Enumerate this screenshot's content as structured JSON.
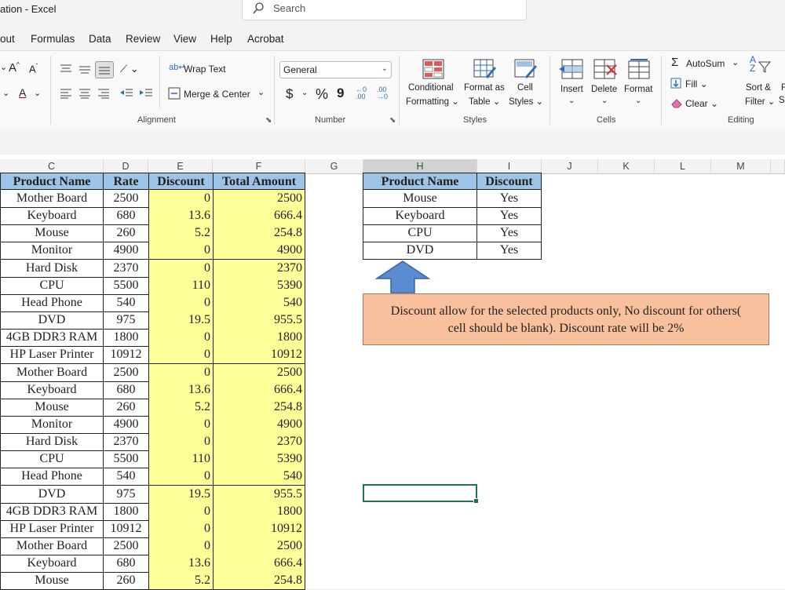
{
  "title_bar": {
    "app_title": "ation  -  Excel",
    "search_placeholder": "Search"
  },
  "menu_tabs": [
    "out",
    "Formulas",
    "Data",
    "Review",
    "View",
    "Help",
    "Acrobat"
  ],
  "ribbon": {
    "alignment": {
      "wrap_text": "Wrap Text",
      "merge_center": "Merge & Center",
      "label": "Alignment"
    },
    "number": {
      "format_value": "General",
      "currency": "$",
      "percent": "%",
      "comma": "9",
      "label": "Number"
    },
    "styles": {
      "conditional_1": "Conditional",
      "conditional_2": "Formatting",
      "format_table_1": "Format as",
      "format_table_2": "Table",
      "cell_styles_1": "Cell",
      "cell_styles_2": "Styles",
      "label": "Styles"
    },
    "cells": {
      "insert": "Insert",
      "delete": "Delete",
      "format": "Format",
      "label": "Cells"
    },
    "editing": {
      "autosum": "AutoSum",
      "fill": "Fill",
      "clear": "Clear",
      "sort_1": "Sort &",
      "sort_2": "Filter",
      "find": "F",
      "find2": "S",
      "label": "Editing"
    },
    "font": {
      "grow": "A",
      "shrink": "A",
      "color": "A"
    }
  },
  "columns": [
    "C",
    "D",
    "E",
    "F",
    "G",
    "H",
    "I",
    "J",
    "K",
    "L",
    "M"
  ],
  "main_table": {
    "headers": [
      "Product Name",
      "Rate",
      "Discount",
      "Total Amount"
    ],
    "rows": [
      [
        "Mother Board",
        "2500",
        "0",
        "2500"
      ],
      [
        "Keyboard",
        "680",
        "13.6",
        "666.4"
      ],
      [
        "Mouse",
        "260",
        "5.2",
        "254.8"
      ],
      [
        "Monitor",
        "4900",
        "0",
        "4900"
      ],
      [
        "Hard Disk",
        "2370",
        "0",
        "2370"
      ],
      [
        "CPU",
        "5500",
        "110",
        "5390"
      ],
      [
        "Head Phone",
        "540",
        "0",
        "540"
      ],
      [
        "DVD",
        "975",
        "19.5",
        "955.5"
      ],
      [
        "4GB DDR3 RAM",
        "1800",
        "0",
        "1800"
      ],
      [
        "HP Laser Printer",
        "10912",
        "0",
        "10912"
      ],
      [
        "Mother Board",
        "2500",
        "0",
        "2500"
      ],
      [
        "Keyboard",
        "680",
        "13.6",
        "666.4"
      ],
      [
        "Mouse",
        "260",
        "5.2",
        "254.8"
      ],
      [
        "Monitor",
        "4900",
        "0",
        "4900"
      ],
      [
        "Hard Disk",
        "2370",
        "0",
        "2370"
      ],
      [
        "CPU",
        "5500",
        "110",
        "5390"
      ],
      [
        "Head Phone",
        "540",
        "0",
        "540"
      ],
      [
        "DVD",
        "975",
        "19.5",
        "955.5"
      ],
      [
        "4GB DDR3 RAM",
        "1800",
        "0",
        "1800"
      ],
      [
        "HP Laser Printer",
        "10912",
        "0",
        "10912"
      ],
      [
        "Mother Board",
        "2500",
        "0",
        "2500"
      ],
      [
        "Keyboard",
        "680",
        "13.6",
        "666.4"
      ],
      [
        "Mouse",
        "260",
        "5.2",
        "254.8"
      ]
    ]
  },
  "lookup_table": {
    "headers": [
      "Product Name",
      "Discount"
    ],
    "rows": [
      [
        "Mouse",
        "Yes"
      ],
      [
        "Keyboard",
        "Yes"
      ],
      [
        "CPU",
        "Yes"
      ],
      [
        "DVD",
        "Yes"
      ]
    ]
  },
  "note": {
    "line1": "Discount allow for the selected products only, No discount for others(",
    "line2": "cell should be blank). Discount rate will be 2%"
  },
  "colors": {
    "header_fill": "#9dc3e6",
    "discount_fill": "#ffff99",
    "note_fill": "#f8c09d",
    "arrow_fill": "#5b8bd0",
    "selection": "#217346"
  }
}
